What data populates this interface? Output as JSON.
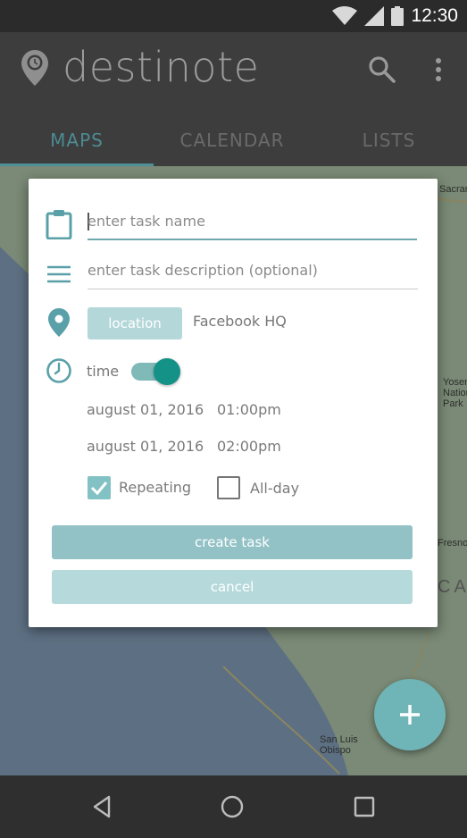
{
  "status_bar": {
    "time": "12:30",
    "icons": [
      "wifi-icon",
      "cell-signal-icon",
      "battery-icon"
    ]
  },
  "app_bar": {
    "title": "destinote",
    "logo_icon": "location-pin-logo-icon",
    "actions": [
      "search-icon",
      "more-vert-icon"
    ]
  },
  "tabs": [
    {
      "label": "MAPS",
      "active": true
    },
    {
      "label": "CALENDAR",
      "active": false
    },
    {
      "label": "LISTS",
      "active": false
    }
  ],
  "map": {
    "labels": [
      "Sacramento",
      "Yosemite National Park",
      "Fresno",
      "CALIFORNIA",
      "San Luis Obispo"
    ]
  },
  "dialog": {
    "task_name": {
      "value": "",
      "placeholder": "enter task name",
      "icon": "clipboard-icon"
    },
    "task_description": {
      "value": "",
      "placeholder": "enter task description (optional)",
      "icon": "menu-lines-icon"
    },
    "location": {
      "button_label": "location",
      "value": "Facebook HQ",
      "icon": "location-pin-icon"
    },
    "time": {
      "label": "time",
      "enabled": true,
      "icon": "clock-icon"
    },
    "start": {
      "date": "august 01, 2016",
      "time": "01:00pm"
    },
    "end": {
      "date": "august 01, 2016",
      "time": "02:00pm"
    },
    "repeating": {
      "label": "Repeating",
      "checked": true
    },
    "all_day": {
      "label": "All-day",
      "checked": false
    },
    "create_label": "create task",
    "cancel_label": "cancel"
  },
  "fab": {
    "icon": "plus-icon"
  },
  "nav_bar": {
    "icons": [
      "back-triangle-icon",
      "home-circle-icon",
      "recents-square-icon"
    ]
  },
  "colors": {
    "accent": "#4f8f96",
    "toggle": "#149287",
    "button_primary": "#92c2c6",
    "button_secondary": "#b6d9dc",
    "fab": "#6fb5b7"
  }
}
